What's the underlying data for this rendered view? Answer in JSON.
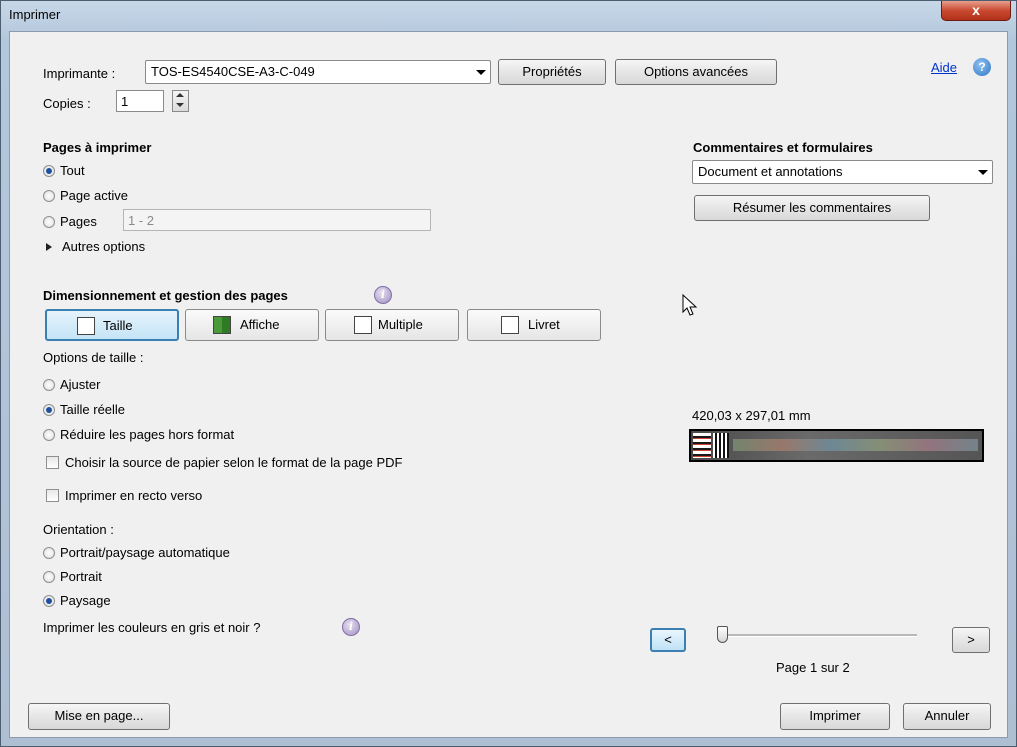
{
  "window": {
    "title": "Imprimer",
    "close_label": "x"
  },
  "printer": {
    "label": "Imprimante :",
    "value": "TOS-ES4540CSE-A3-C-049",
    "properties_btn": "Propriétés",
    "advanced_btn": "Options avancées"
  },
  "help": {
    "label": "Aide",
    "icon": "help-icon"
  },
  "copies": {
    "label": "Copies :",
    "value": "1"
  },
  "pages": {
    "heading": "Pages à imprimer",
    "all": "Tout",
    "current": "Page active",
    "range_label": "Pages",
    "range_value": "1 - 2",
    "more_options": "Autres options",
    "selected": "all"
  },
  "comments": {
    "heading": "Commentaires et formulaires",
    "value": "Document et annotations",
    "summarize_btn": "Résumer les commentaires"
  },
  "sizing": {
    "heading": "Dimensionnement et gestion des pages",
    "tabs": [
      {
        "label": "Taille",
        "icon": "size-icon"
      },
      {
        "label": "Affiche",
        "icon": "poster-icon"
      },
      {
        "label": "Multiple",
        "icon": "multiple-icon"
      },
      {
        "label": "Livret",
        "icon": "booklet-icon"
      }
    ],
    "selected_tab": "Taille",
    "options_label": "Options de taille :",
    "fit": "Ajuster",
    "actual": "Taille réelle",
    "shrink": "Réduire les pages hors format",
    "selected_option": "actual",
    "paper_source": "Choisir la source de papier selon le format de la page PDF",
    "duplex": "Imprimer en recto verso"
  },
  "orientation": {
    "label": "Orientation :",
    "auto": "Portrait/paysage automatique",
    "portrait": "Portrait",
    "landscape": "Paysage",
    "selected": "landscape"
  },
  "grayscale_label": "Imprimer les couleurs en gris et noir ?",
  "preview": {
    "dimensions": "420,03 x 297,01 mm",
    "prev_btn": "<",
    "next_btn": ">",
    "page_status": "Page 1 sur 2",
    "slider_position": 0
  },
  "footer": {
    "page_setup_btn": "Mise en page...",
    "print_btn": "Imprimer",
    "cancel_btn": "Annuler"
  },
  "colors": {
    "accent": "#3c7fb1",
    "title_bar": "#b3c7dc",
    "close": "#c94a30",
    "link": "#0033cc"
  }
}
